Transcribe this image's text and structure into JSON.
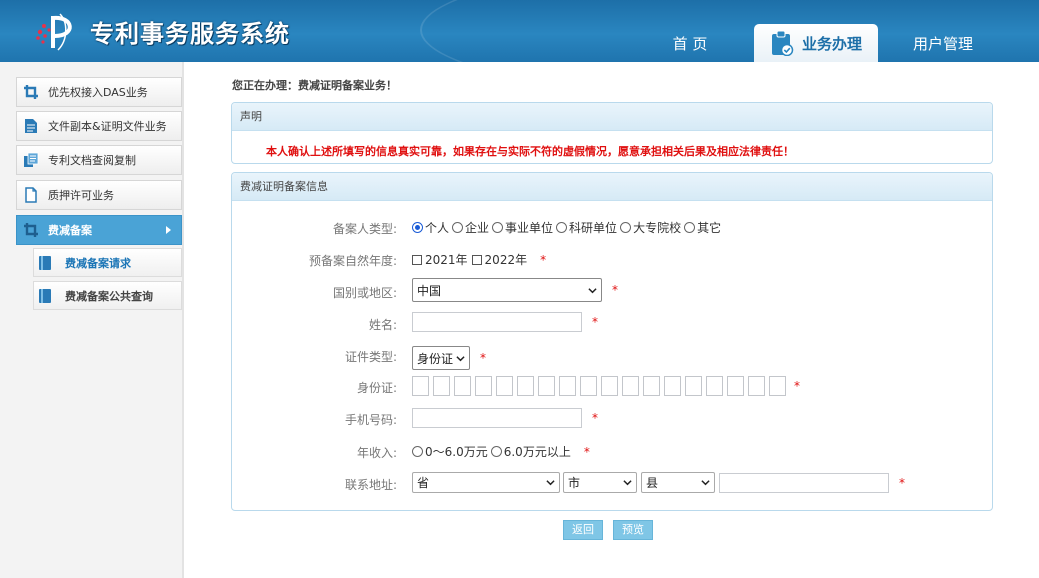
{
  "header": {
    "app_title": "专利事务服务系统",
    "nav": {
      "home": "首 页",
      "business": "业务办理",
      "users": "用户管理"
    }
  },
  "sidebar": {
    "items": [
      {
        "label": "优先权接入DAS业务",
        "icon": "crop-icon"
      },
      {
        "label": "文件副本&证明文件业务",
        "icon": "document-icon"
      },
      {
        "label": "专利文档查阅复制",
        "icon": "copy-document-icon"
      },
      {
        "label": "质押许可业务",
        "icon": "file-icon"
      },
      {
        "label": "费减备案",
        "icon": "crop-icon",
        "active": true
      }
    ],
    "sub_items": [
      {
        "label": "费减备案请求",
        "icon": "book-icon",
        "active": true
      },
      {
        "label": "费减备案公共查询",
        "icon": "book-icon"
      }
    ]
  },
  "main": {
    "status_text": "您正在办理：费减证明备案业务！",
    "declaration": {
      "title": "声明",
      "text": "本人确认上述所填写的信息真实可靠，如果存在与实际不符的虚假情况，愿意承担相关后果及相应法律责任！"
    },
    "form": {
      "title": "费减证明备案信息",
      "applicant_type": {
        "label": "备案人类型:",
        "options": [
          "个人",
          "企业",
          "事业单位",
          "科研单位",
          "大专院校",
          "其它"
        ],
        "selected": "个人"
      },
      "year": {
        "label": "预备案自然年度:",
        "options": [
          "2021年",
          "2022年"
        ]
      },
      "country": {
        "label": "国别或地区:",
        "value": "中国"
      },
      "name": {
        "label": "姓名:",
        "value": ""
      },
      "id_type": {
        "label": "证件类型:",
        "value": "身份证"
      },
      "id_number": {
        "label": "身份证:"
      },
      "phone": {
        "label": "手机号码:",
        "value": ""
      },
      "income": {
        "label": "年收入:",
        "options": [
          "0～6.0万元",
          "6.0万元以上"
        ]
      },
      "address": {
        "label": "联系地址:",
        "province": "省",
        "city": "市",
        "county": "县",
        "detail": ""
      },
      "required_mark": "*"
    },
    "buttons": {
      "back": "返回",
      "preview": "预览"
    }
  },
  "colors": {
    "header": "#1d6fa8",
    "accent": "#4aa3d6",
    "required": "#e01010",
    "button": "#7fc6e6"
  }
}
